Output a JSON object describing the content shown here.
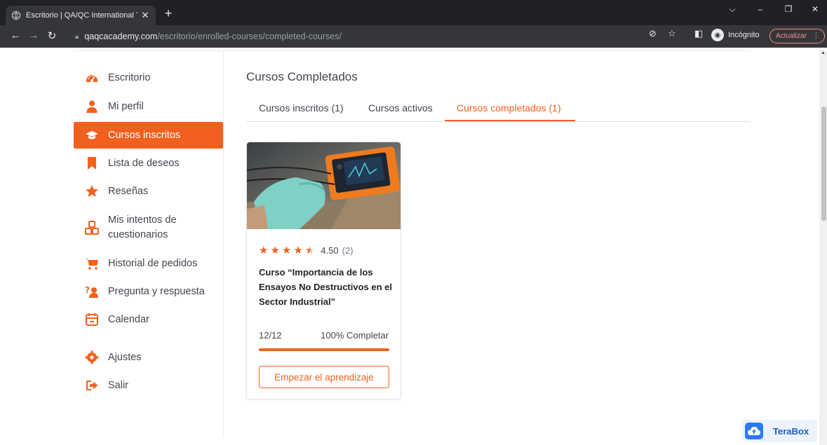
{
  "browser": {
    "tab_title": "Escritorio | QA/QC International T",
    "close_glyph": "✕",
    "new_tab_glyph": "+",
    "url_host": "qaqcacademy.com",
    "url_path": "/escritorio/enrolled-courses/completed-courses/",
    "incognito_label": "Incógnito",
    "update_label": "Actualizar",
    "menu_glyph": "⋮"
  },
  "sidebar": {
    "items": [
      {
        "label": "Escritorio",
        "icon": "dashboard-icon"
      },
      {
        "label": "Mi perfil",
        "icon": "user-icon"
      },
      {
        "label": "Cursos inscritos",
        "icon": "graduation-cap-icon",
        "active": true
      },
      {
        "label": "Lista de deseos",
        "icon": "bookmark-icon"
      },
      {
        "label": "Reseñas",
        "icon": "star-icon"
      },
      {
        "label": "Mis intentos de cuestionarios",
        "icon": "quiz-attempts-icon"
      },
      {
        "label": "Historial de pedidos",
        "icon": "cart-icon"
      },
      {
        "label": "Pregunta y respuesta",
        "icon": "question-answer-icon"
      },
      {
        "label": "Calendar",
        "icon": "calendar-icon"
      },
      {
        "label": "Ajustes",
        "icon": "gear-icon"
      },
      {
        "label": "Salir",
        "icon": "logout-icon"
      }
    ]
  },
  "main": {
    "title": "Cursos Completados",
    "tabs": [
      {
        "label": "Cursos inscritos (1)"
      },
      {
        "label": "Cursos activos"
      },
      {
        "label": "Cursos completados (1)",
        "active": true
      }
    ]
  },
  "course": {
    "rating": "4.50",
    "rating_count": "(2)",
    "rating_value": 4.5,
    "title": "Curso “Importancia de los Ensayos No Destructivos en el Sector Industrial”",
    "progress_count": "12/12",
    "progress_label": "100% Completar",
    "progress_fraction": 1.0,
    "button_label": "Empezar el aprendizaje"
  },
  "widget": {
    "label": "TeraBox"
  },
  "colors": {
    "accent": "#f2601e",
    "text": "#41454f",
    "chrome_dark": "#202124"
  }
}
